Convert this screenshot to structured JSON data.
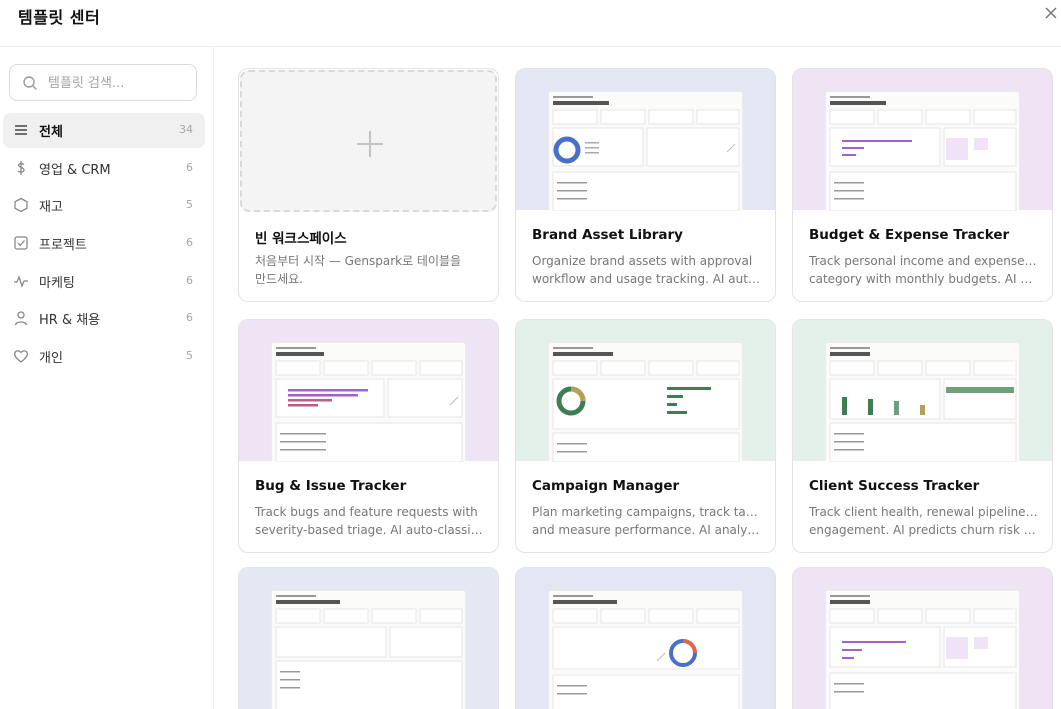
{
  "header": {
    "title": "템플릿 센터"
  },
  "search": {
    "placeholder": "템플릿 검색..."
  },
  "categories": [
    {
      "label": "전체",
      "count": "34",
      "icon": "list-icon"
    },
    {
      "label": "영업 & CRM",
      "count": "6",
      "icon": "dollar-icon"
    },
    {
      "label": "재고",
      "count": "5",
      "icon": "hexagon-icon"
    },
    {
      "label": "프로젝트",
      "count": "6",
      "icon": "checkbox-icon"
    },
    {
      "label": "마케팅",
      "count": "6",
      "icon": "activity-icon"
    },
    {
      "label": "HR & 채용",
      "count": "6",
      "icon": "person-icon"
    },
    {
      "label": "개인",
      "count": "5",
      "icon": "heart-icon"
    }
  ],
  "templates": [
    {
      "title": "빈 워크스페이스",
      "desc1": "처음부터 시작 — Genspark로 테이블을",
      "desc2": "만드세요."
    },
    {
      "title": "Brand Asset Library",
      "desc1": "Organize brand assets with approval",
      "desc2": "workflow and usage tracking. AI auto-...",
      "color": "#e4e6f4"
    },
    {
      "title": "Budget & Expense Tracker",
      "desc1": "Track personal income and expenses by",
      "desc2": "category with monthly budgets. AI aut...",
      "color": "#efe4f4"
    },
    {
      "title": "Bug & Issue Tracker",
      "desc1": "Track bugs and feature requests with",
      "desc2": "severity-based triage. AI auto-classifies...",
      "color": "#efe4f4"
    },
    {
      "title": "Campaign Manager",
      "desc1": "Plan marketing campaigns, track tasks,",
      "desc2": "and measure performance. AI analyzes...",
      "color": "#e3f1ea"
    },
    {
      "title": "Client Success Tracker",
      "desc1": "Track client health, renewal pipeline, and",
      "desc2": "engagement. AI predicts churn risk and...",
      "color": "#e3f1ea"
    },
    {
      "color": "#e4e8f2"
    },
    {
      "color": "#e4e6f4"
    },
    {
      "color": "#efe4f4"
    }
  ],
  "colors": {
    "accent_purple": "#a061c9",
    "accent_green": "#3f7d52",
    "accent_blue": "#4a6fc7"
  }
}
